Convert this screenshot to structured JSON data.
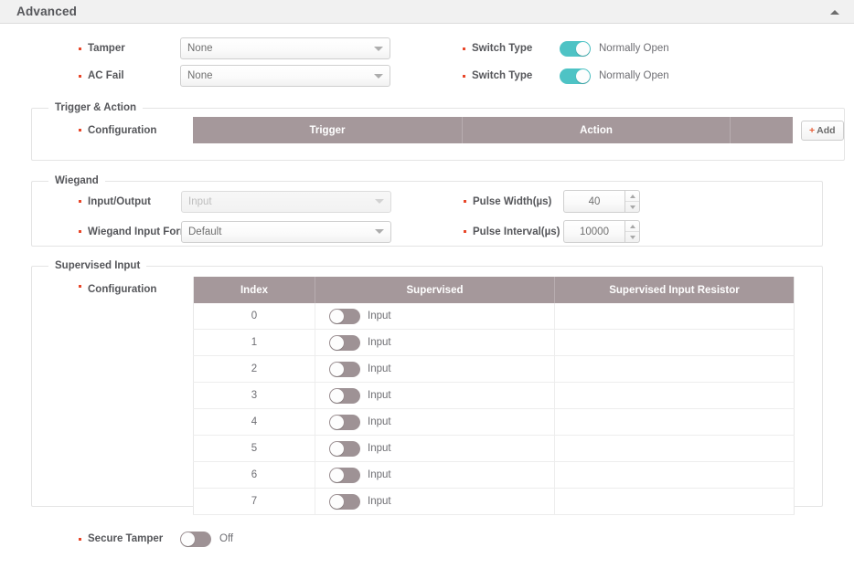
{
  "panel": {
    "title": "Advanced",
    "collapse_icon": "chevron-up-icon"
  },
  "top_fields": {
    "rows": [
      {
        "label": "Tamper",
        "select_value": "None",
        "switch_label": "Switch Type",
        "switch_state": "on",
        "switch_text": "Normally Open"
      },
      {
        "label": "AC Fail",
        "select_value": "None",
        "switch_label": "Switch Type",
        "switch_state": "on",
        "switch_text": "Normally Open"
      }
    ]
  },
  "trigger_action": {
    "legend": "Trigger & Action",
    "config_label": "Configuration",
    "columns": [
      "Trigger",
      "Action",
      ""
    ],
    "rows": [],
    "add_label": "Add",
    "add_plus": "+"
  },
  "wiegand": {
    "legend": "Wiegand",
    "input_output": {
      "label": "Input/Output",
      "value": "Input",
      "disabled": true
    },
    "input_format": {
      "label": "Wiegand Input Format",
      "value": "Default",
      "disabled": false
    },
    "pulse_width": {
      "label": "Pulse Width(µs)",
      "value": "40"
    },
    "pulse_interval": {
      "label": "Pulse Interval(µs)",
      "value": "10000"
    }
  },
  "supervised_input": {
    "legend": "Supervised Input",
    "config_label": "Configuration",
    "columns": [
      "Index",
      "Supervised",
      "Supervised Input Resistor"
    ],
    "rows": [
      {
        "index": "0",
        "supervised_state": "off",
        "supervised_text": "Input",
        "resistor": ""
      },
      {
        "index": "1",
        "supervised_state": "off",
        "supervised_text": "Input",
        "resistor": ""
      },
      {
        "index": "2",
        "supervised_state": "off",
        "supervised_text": "Input",
        "resistor": ""
      },
      {
        "index": "3",
        "supervised_state": "off",
        "supervised_text": "Input",
        "resistor": ""
      },
      {
        "index": "4",
        "supervised_state": "off",
        "supervised_text": "Input",
        "resistor": ""
      },
      {
        "index": "5",
        "supervised_state": "off",
        "supervised_text": "Input",
        "resistor": ""
      },
      {
        "index": "6",
        "supervised_state": "off",
        "supervised_text": "Input",
        "resistor": ""
      },
      {
        "index": "7",
        "supervised_state": "off",
        "supervised_text": "Input",
        "resistor": ""
      }
    ]
  },
  "secure_tamper": {
    "label": "Secure Tamper",
    "state": "off",
    "text": "Off"
  },
  "colors": {
    "toggle_on": "#4ec3c5",
    "toggle_off": "#9e9295",
    "table_header": "#a5989b",
    "bullet": "#e8472a",
    "add_plus": "#e8603a",
    "header_bg": "#f1f1f1"
  }
}
